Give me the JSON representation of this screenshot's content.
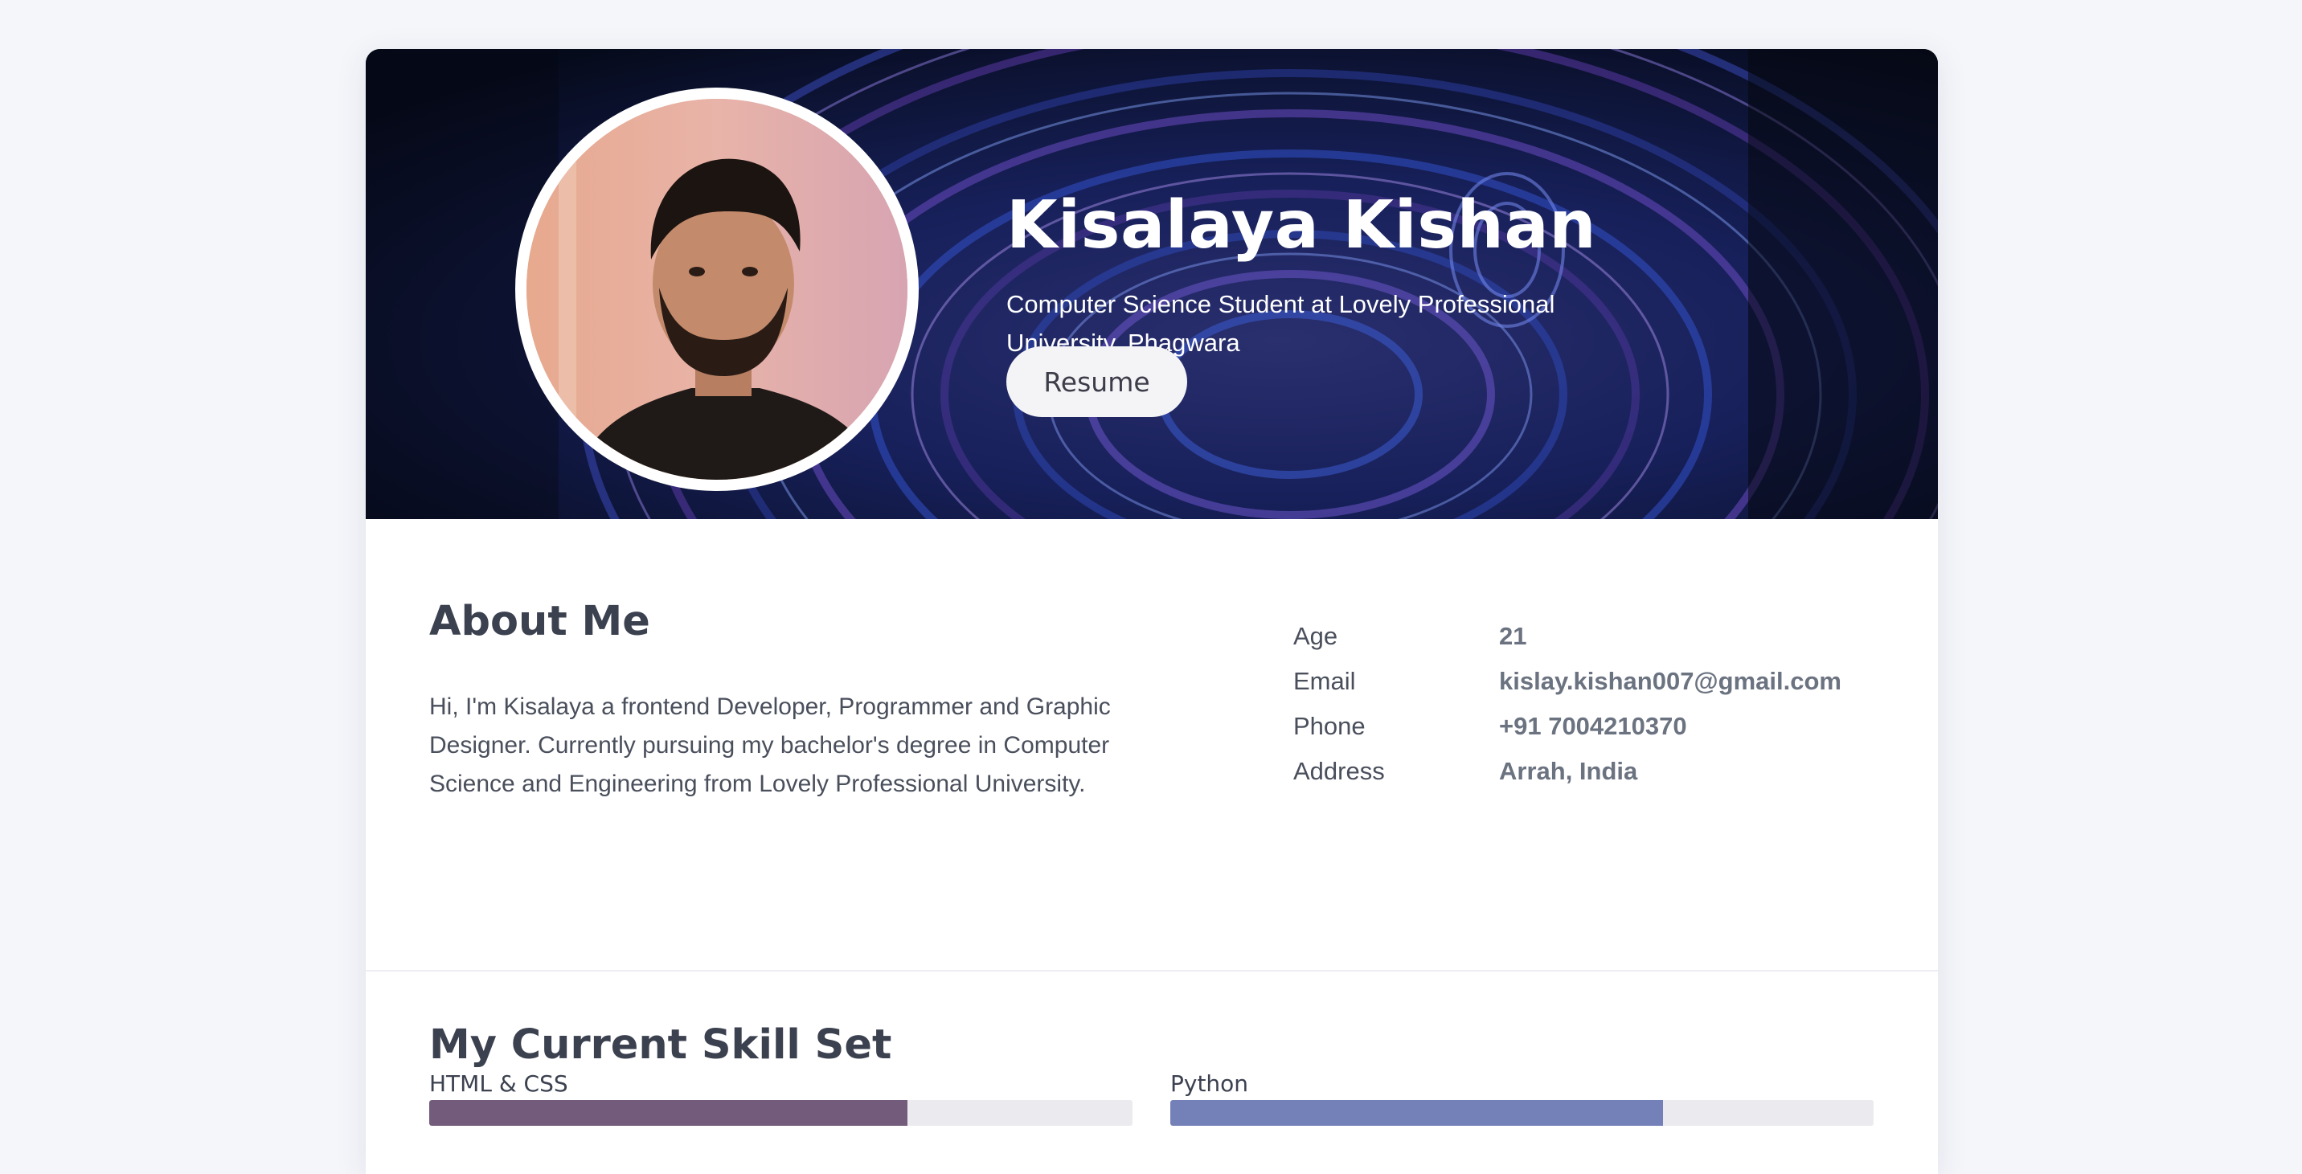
{
  "profile": {
    "name": "Kisalaya Kishan",
    "subtitle": "Computer Science Student at Lovely Professional University, Phagwara",
    "resume_label": "Resume"
  },
  "about": {
    "title": "About Me",
    "text": "Hi, I'm Kisalaya a frontend Developer, Programmer and Graphic Designer. Currently pursuing my bachelor's degree in Computer Science and Engineering from Lovely Professional University.",
    "info": [
      {
        "label": "Age",
        "value": "21"
      },
      {
        "label": "Email",
        "value": "kislay.kishan007@gmail.com"
      },
      {
        "label": "Phone",
        "value": "+91 7004210370"
      },
      {
        "label": "Address",
        "value": "Arrah, India"
      }
    ]
  },
  "skills": {
    "title": "My Current Skill Set",
    "items": [
      {
        "label": "HTML & CSS",
        "percent": 68,
        "color": "#735c7b"
      },
      {
        "label": "Python",
        "percent": 70,
        "color": "#7381b8"
      }
    ]
  },
  "colors": {
    "page_background": "#f5f6fa",
    "card_background": "#ffffff",
    "heading": "#3c4150",
    "hero_background": "#0b1530"
  },
  "icons": {
    "hero_image": "abstract-fluid-art-image",
    "avatar": "profile-photo"
  }
}
